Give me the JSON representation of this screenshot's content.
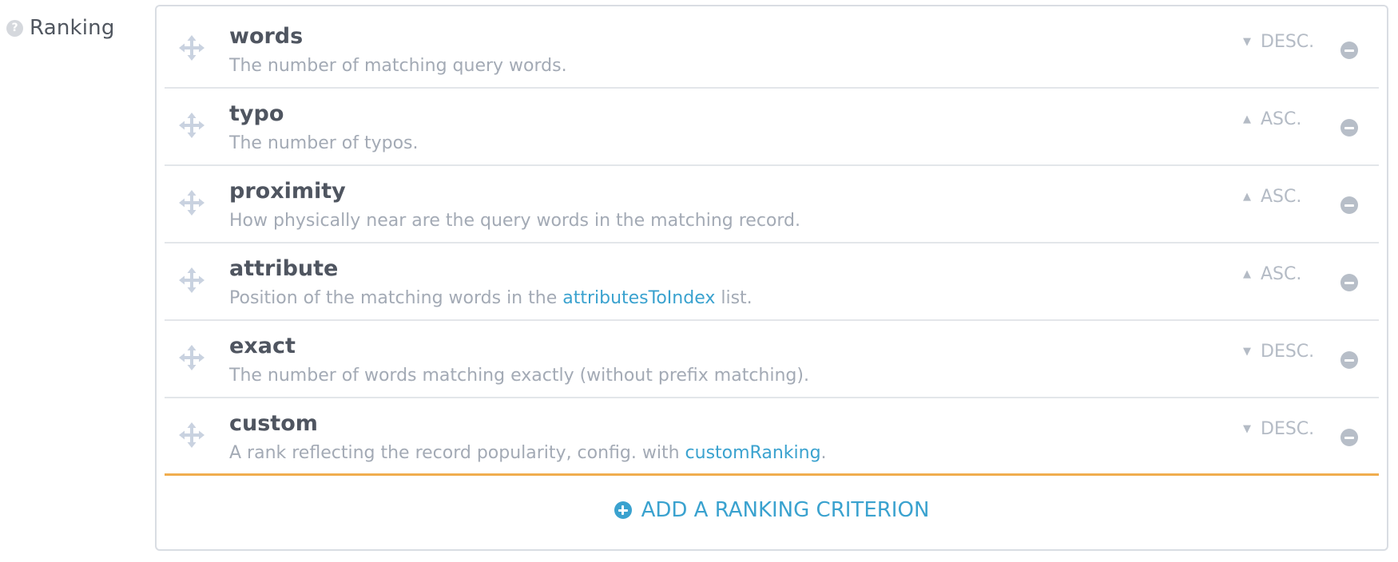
{
  "section": {
    "help_icon": "question-mark",
    "label": "Ranking"
  },
  "criteria": [
    {
      "name": "words",
      "description": "The number of matching query words.",
      "desc_link": "",
      "desc_suffix": "",
      "order": "DESC.",
      "order_icon": "caret-down"
    },
    {
      "name": "typo",
      "description": "The number of typos.",
      "desc_link": "",
      "desc_suffix": "",
      "order": "ASC.",
      "order_icon": "caret-up"
    },
    {
      "name": "proximity",
      "description": "How physically near are the query words in the matching record.",
      "desc_link": "",
      "desc_suffix": "",
      "order": "ASC.",
      "order_icon": "caret-up"
    },
    {
      "name": "attribute",
      "description": "Position of the matching words in the ",
      "desc_link": "attributesToIndex",
      "desc_suffix": " list.",
      "order": "ASC.",
      "order_icon": "caret-up"
    },
    {
      "name": "exact",
      "description": "The number of words matching exactly (without prefix matching).",
      "desc_link": "",
      "desc_suffix": "",
      "order": "DESC.",
      "order_icon": "caret-down"
    },
    {
      "name": "custom",
      "description": "A rank reflecting the record popularity, config. with ",
      "desc_link": "customRanking",
      "desc_suffix": ".",
      "order": "DESC.",
      "order_icon": "caret-down"
    }
  ],
  "add_button": {
    "label": "ADD A RANKING CRITERION",
    "icon": "plus-circle-icon"
  },
  "colors": {
    "accent": "#3aa2cf",
    "highlight_border": "#f0ad4e",
    "muted": "#a3aab5"
  }
}
